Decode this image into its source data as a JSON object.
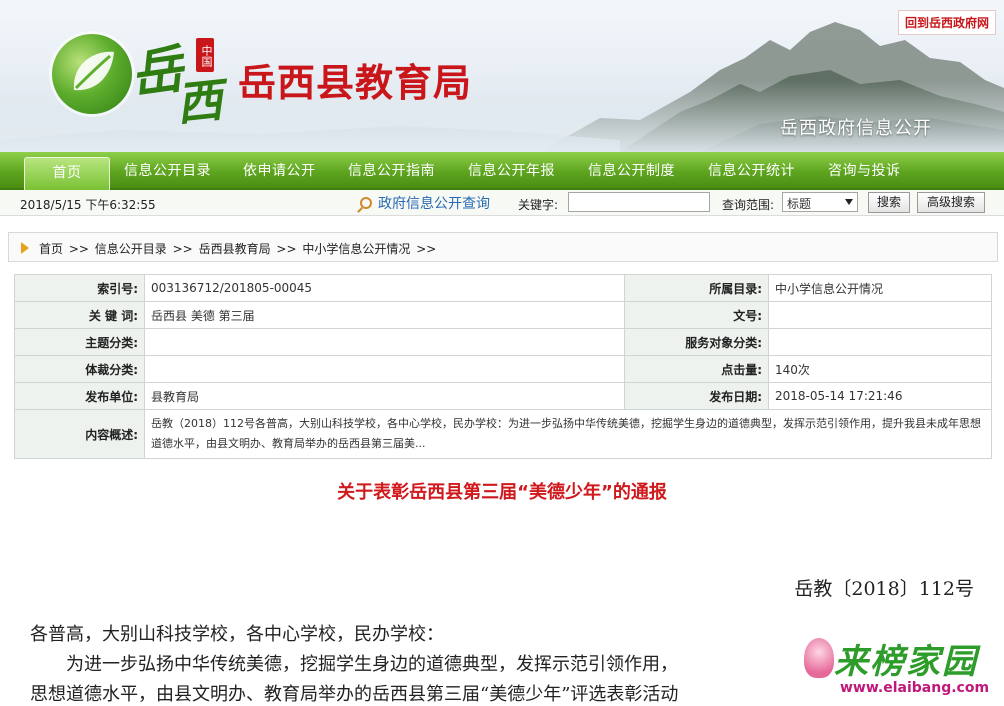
{
  "header": {
    "logo_zhongguo": "中国",
    "logo_yue": "岳",
    "logo_xi": "西",
    "site_title": "岳西县教育局",
    "return_link": "回到岳西政府网",
    "gov_info_label": "岳西政府信息公开"
  },
  "nav": {
    "items": [
      {
        "label": "首页",
        "active": true
      },
      {
        "label": "信息公开目录"
      },
      {
        "label": "依申请公开"
      },
      {
        "label": "信息公开指南"
      },
      {
        "label": "信息公开年报"
      },
      {
        "label": "信息公开制度"
      },
      {
        "label": "信息公开统计"
      },
      {
        "label": "咨询与投诉"
      }
    ]
  },
  "infobar": {
    "datetime": "2018/5/15 下午6:32:55",
    "query_link": "政府信息公开查询",
    "keyword_label": "关键字:",
    "keyword_value": "",
    "range_label": "查询范围:",
    "range_selected": "标题",
    "search_button": "搜索",
    "advanced_button": "高级搜索"
  },
  "breadcrumb": {
    "items": [
      "首页",
      "信息公开目录",
      "岳西县教育局",
      "中小学信息公开情况"
    ],
    "separator": ">>"
  },
  "meta": {
    "index_label": "索引号:",
    "index_value": "003136712/201805-00045",
    "catalog_label": "所属目录:",
    "catalog_value": "中小学信息公开情况",
    "keywords_label": "关 键 词:",
    "keywords_value": "岳西县 美德 第三届",
    "docno_label": "文号:",
    "docno_value": "",
    "topic_label": "主题分类:",
    "topic_value": "",
    "service_label": "服务对象分类:",
    "service_value": "",
    "genre_label": "体裁分类:",
    "genre_value": "",
    "hits_label": "点击量:",
    "hits_value": "140次",
    "publisher_label": "发布单位:",
    "publisher_value": "县教育局",
    "date_label": "发布日期:",
    "date_value": "2018-05-14 17:21:46",
    "summary_label": "内容概述:",
    "summary_value": "岳教（2018）112号各普高，大别山科技学校，各中心学校，民办学校：为进一步弘扬中华传统美德，挖掘学生身边的道德典型，发挥示范引领作用，提升我县未成年思想道德水平，由县文明办、教育局举办的岳西县第三届美..."
  },
  "article": {
    "title": "关于表彰岳西县第三届“美德少年”的通报",
    "doc_no": "岳教〔2018〕112号",
    "line1": "各普高，大别山科技学校，各中心学校，民办学校：",
    "line2": "为进一步弘扬中华传统美德，挖掘学生身边的道德典型，发挥示范引领作用，",
    "line3": "思想道德水平，由县文明办、教育局举办的岳西县第三届“美德少年”评选表彰活动"
  },
  "watermark": {
    "brand": "来榜家园",
    "url": "www.elaibang.com"
  },
  "colors": {
    "title_red": "#c9161a",
    "nav_green": "#5ea51f",
    "link_blue": "#2a6ab5"
  }
}
